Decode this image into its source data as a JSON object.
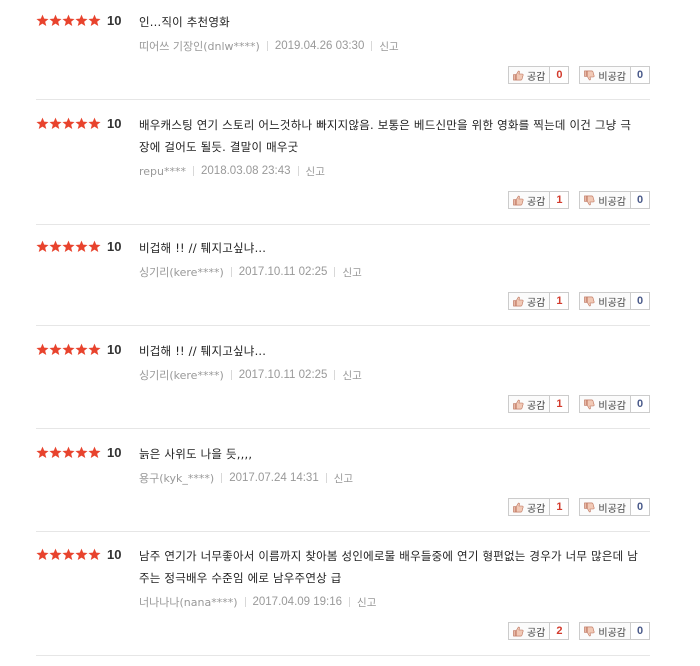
{
  "labels": {
    "like": "공감",
    "dislike": "비공감",
    "report": "신고"
  },
  "colors": {
    "star": "#e8432d",
    "like_count": "#d33a2c",
    "dislike_count": "#4a5a8a"
  },
  "reviews": [
    {
      "rating": "10",
      "stars": 5,
      "text": "인...직이 추천영화",
      "author": "띠어쓰 기장인(dnlw****)",
      "date": "2019.04.26 03:30",
      "likes": "0",
      "dislikes": "0"
    },
    {
      "rating": "10",
      "stars": 5,
      "text": "배우캐스팅 연기 스토리 어느것하나 빠지지않음. 보통은 베드신만을 위한 영화를 찍는데 이건 그냥 극장에 걸어도 될듯. 결말이 매우굿",
      "author": "repu****",
      "date": "2018.03.08 23:43",
      "likes": "1",
      "dislikes": "0"
    },
    {
      "rating": "10",
      "stars": 5,
      "text": "비겁해 !! // 퉤지고싶냐...",
      "author": "싱기리(kere****)",
      "date": "2017.10.11 02:25",
      "likes": "1",
      "dislikes": "0"
    },
    {
      "rating": "10",
      "stars": 5,
      "text": "비겁해 !! // 퉤지고싶냐...",
      "author": "싱기리(kere****)",
      "date": "2017.10.11 02:25",
      "likes": "1",
      "dislikes": "0"
    },
    {
      "rating": "10",
      "stars": 5,
      "text": "늙은 사위도 나을 듯,,,,",
      "author": "용구(kyk_****)",
      "date": "2017.07.24 14:31",
      "likes": "1",
      "dislikes": "0"
    },
    {
      "rating": "10",
      "stars": 5,
      "text": "남주 연기가 너무좋아서 이름까지 찾아봄 성인에로물 배우들중에 연기 형편없는 경우가 너무 많은데 남주는 정극배우 수준임 에로 남우주연상 급",
      "author": "너나나나(nana****)",
      "date": "2017.04.09 19:16",
      "likes": "2",
      "dislikes": "0"
    }
  ]
}
